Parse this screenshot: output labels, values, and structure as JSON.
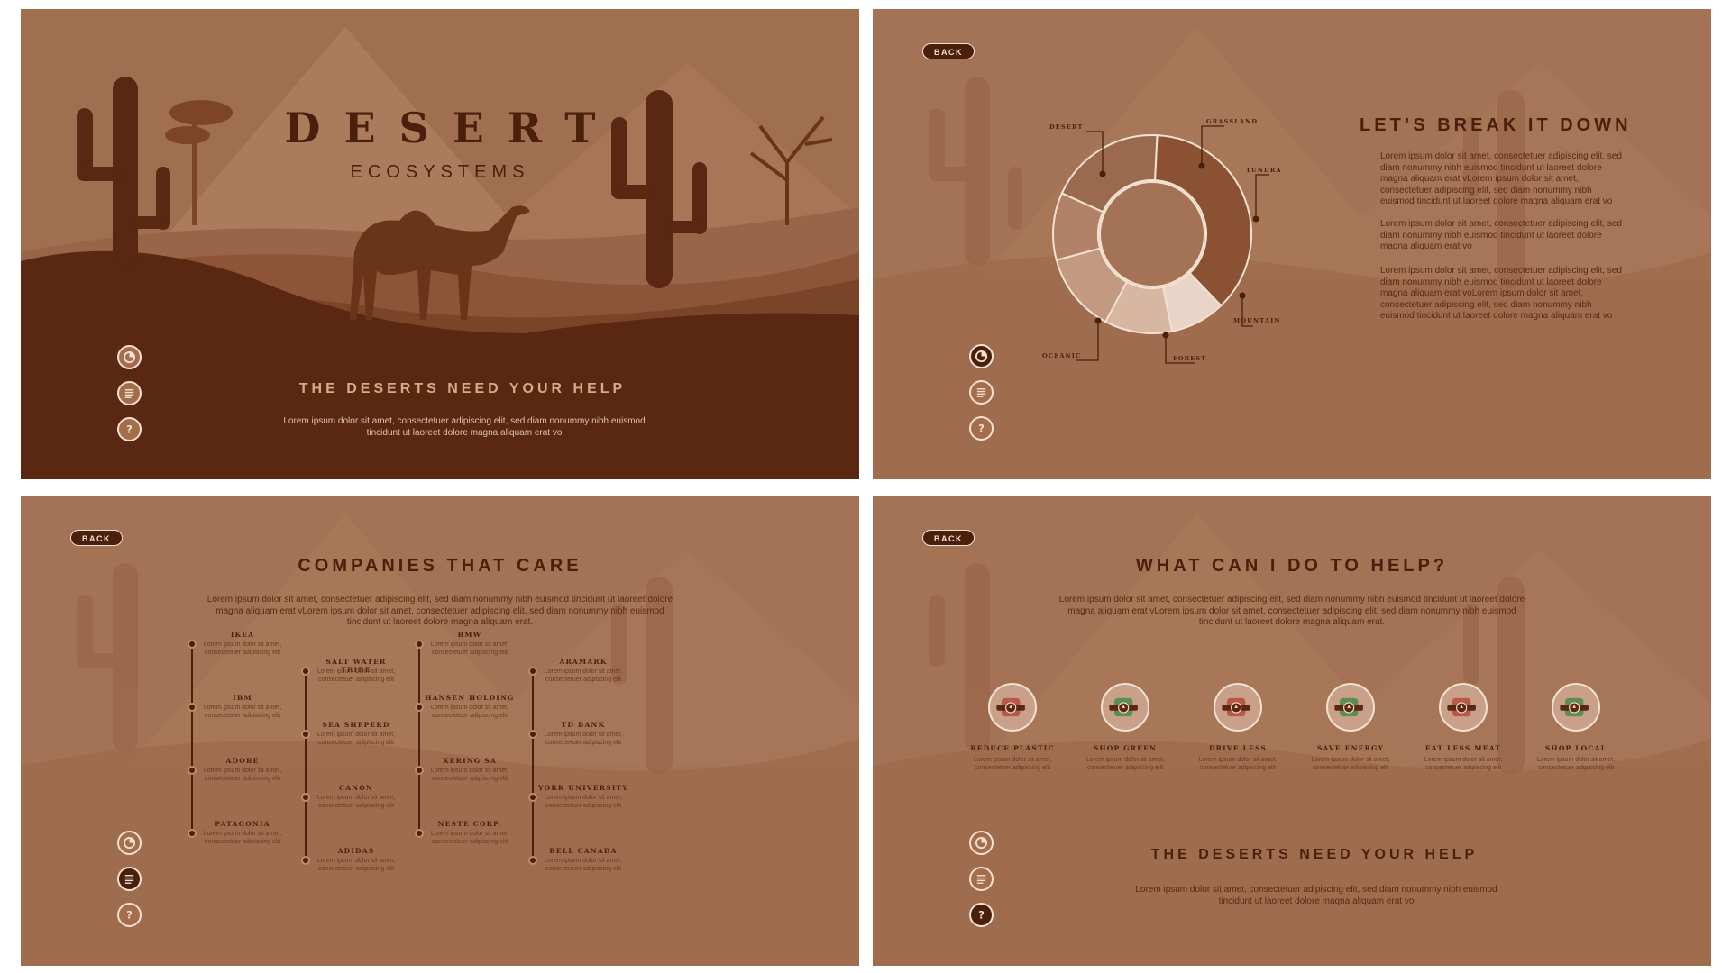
{
  "slide1": {
    "title": "DESERT",
    "subtitle": "ECOSYSTEMS",
    "heading": "THE DESERTS NEED YOUR HELP",
    "body": "Lorem ipsum dolor sit amet, consectetuer adipiscing elit, sed diam nonummy nibh euismod tincidunt ut laoreet dolore magna aliquam erat vo"
  },
  "slide2": {
    "back": "BACK",
    "title": "LET’S BREAK IT DOWN",
    "paragraphs": [
      "Lorem ipsum dolor sit amet, consectetuer adipiscing elit, sed diam nonummy nibh euismod tincidunt ut laoreet dolore magna aliquam erat vLorem ipsum dolor sit amet, consectetuer adipiscing elit, sed diam nonummy nibh euismod tincidunt ut laoreet dolore magna aliquam erat vo",
      "Lorem ipsum dolor sit amet, consectetuer adipiscing elit, sed diam nonummy nibh euismod tincidunt ut laoreet dolore magna aliquam erat vo",
      "Lorem ipsum dolor sit amet, consectetuer adipiscing elit, sed diam nonummy nibh euismod tincidunt ut laoreet dolore magna aliquam erat voLorem ipsum dolor sit amet, consectetuer adipiscing elit, sed diam nonummy nibh euismod tincidunt ut laoreet dolore magna aliquam erat vo"
    ],
    "donut_labels": [
      "DESERT",
      "GRASSLAND",
      "TUNDRA",
      "MOUNTAIN",
      "FOREST",
      "OCEANIC"
    ]
  },
  "donut": {
    "segments": [
      {
        "name": "DESERT",
        "value": 37,
        "color": "#8a5232"
      },
      {
        "name": "GRASSLAND",
        "value": 9,
        "color": "#e9d4c8"
      },
      {
        "name": "TUNDRA",
        "value": 11,
        "color": "#d7b6a2"
      },
      {
        "name": "MOUNTAIN",
        "value": 13,
        "color": "#c29a82"
      },
      {
        "name": "FOREST",
        "value": 11,
        "color": "#b28268"
      },
      {
        "name": "OCEANIC",
        "value": 19,
        "color": "#9b6a4e"
      }
    ]
  },
  "slide3": {
    "back": "BACK",
    "title": "COMPANIES THAT CARE",
    "intro": "Lorem ipsum dolor sit amet, consectetuer adipiscing elit, sed diam nonummy nibh euismod tincidunt ut laoreet dolore magna aliquam erat vLorem ipsum dolor sit amet, consectetuer adipiscing elit, sed diam nonummy nibh euismod tincidunt ut laoreet dolore magna aliquam erat.",
    "company_desc": "Lorem ipsum dolor sit amet, consectetuer adipiscing elit",
    "columns": [
      [
        "IKEA",
        "IBM",
        "ADOBE",
        "PATAGONIA"
      ],
      [
        "SALT WATER TRIBE",
        "SEA SHEPERD",
        "CANON",
        "ADIDAS"
      ],
      [
        "BMW",
        "HANSEN HOLDING",
        "KERING SA",
        "NESTE CORP."
      ],
      [
        "ARAMARK",
        "TD BANK",
        "YORK UNIVERSITY",
        "BELL CANADA"
      ]
    ]
  },
  "slide4": {
    "back": "BACK",
    "title": "WHAT CAN I DO TO HELP?",
    "intro": "Lorem ipsum dolor sit amet, consectetuer adipiscing elit, sed diam nonummy nibh euismod tincidunt ut laoreet dolore magna aliquam erat vLorem ipsum dolor sit amet, consectetuer adipiscing elit, sed diam nonummy nibh euismod tincidunt ut laoreet dolore magna aliquam erat.",
    "item_desc": "Lorem ipsum dolor sit amet, consectetuer adipiscing elit",
    "items": [
      {
        "label": "REDUCE PLASTIC",
        "icon": "plastic-bottle-icon",
        "color": "#b84a3a"
      },
      {
        "label": "SHOP GREEN",
        "icon": "shopping-bag-icon",
        "color": "#4a8a4a"
      },
      {
        "label": "DRIVE LESS",
        "icon": "car-icon",
        "color": "#b84a3a"
      },
      {
        "label": "SAVE ENERGY",
        "icon": "lightbulb-icon",
        "color": "#4a8a4a"
      },
      {
        "label": "EAT LESS MEAT",
        "icon": "meat-icon",
        "color": "#b84a3a"
      },
      {
        "label": "SHOP LOCAL",
        "icon": "basket-icon",
        "color": "#4a8a4a"
      }
    ],
    "heading": "THE DESERTS NEED YOUR HELP",
    "body": "Lorem ipsum dolor sit amet, consectetuer adipiscing elit, sed diam nonummy nibh euismod tincidunt ut laoreet dolore magna aliquam erat vo"
  },
  "nav_icons": [
    "chart-icon",
    "list-icon",
    "help-icon"
  ]
}
